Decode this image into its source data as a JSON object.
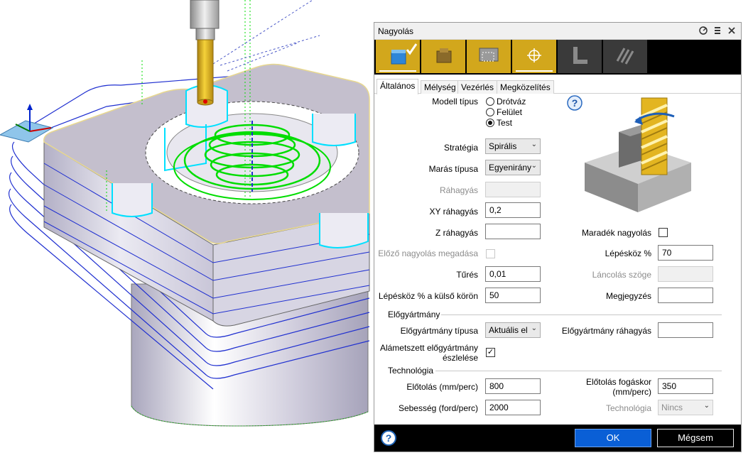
{
  "dialog": {
    "title": "Nagyolás",
    "title_icons": [
      "pin-icon",
      "menu-icon",
      "close-icon"
    ],
    "toolbar": [
      {
        "icon": "pocket-icon",
        "active": true,
        "checked": true
      },
      {
        "icon": "stock-box-icon",
        "active": false
      },
      {
        "icon": "region-icon",
        "active": false
      },
      {
        "icon": "target-icon",
        "active": true
      },
      {
        "icon": "corner-icon",
        "active": false
      },
      {
        "icon": "zigzag-icon",
        "active": false
      }
    ],
    "tabs": [
      "Általános",
      "Mélység",
      "Vezérlés",
      "Megközelítés"
    ],
    "active_tab": "Általános",
    "model_type": {
      "label": "Modell típus",
      "options": [
        "Drótváz",
        "Felület",
        "Test"
      ],
      "selected": "Test"
    },
    "help_glyph": "?",
    "strategy": {
      "label": "Stratégia",
      "value": "Spirális"
    },
    "milling_type": {
      "label": "Marás típusa",
      "value": "Egyenirány"
    },
    "allowance": {
      "label": "Ráhagyás",
      "value": ""
    },
    "xy_allowance": {
      "label": "XY ráhagyás",
      "value": "0,2"
    },
    "z_allowance": {
      "label": "Z ráhagyás",
      "value": ""
    },
    "prev_roughing": {
      "label": "Előző nagyolás megadása",
      "checked": false
    },
    "tolerance": {
      "label": "Tűrés",
      "value": "0,01"
    },
    "outer_stepover": {
      "label": "Lépésköz % a külső körön",
      "value": "50"
    },
    "rest_roughing": {
      "label": "Maradék nagyolás",
      "checked": false
    },
    "stepover": {
      "label": "Lépésköz %",
      "value": "70"
    },
    "chaining_angle": {
      "label": "Láncolás szöge",
      "value": ""
    },
    "note": {
      "label": "Megjegyzés",
      "value": ""
    },
    "stock_section": "Előgyártmány",
    "stock_type": {
      "label": "Előgyártmány típusa",
      "value": "Aktuális el"
    },
    "stock_allowance": {
      "label": "Előgyártmány ráhagyás",
      "value": ""
    },
    "default_stock": {
      "label_line1": "Alámetszett előgyártmány",
      "label_line2": "észlelése",
      "checked": true
    },
    "tech_section": "Technológia",
    "feed": {
      "label": "Előtolás (mm/perc)",
      "value": "800"
    },
    "plunge_feed": {
      "label_line1": "Előtolás fogáskor",
      "label_line2": "(mm/perc)",
      "value": "350"
    },
    "speed": {
      "label": "Sebesség (ford/perc)",
      "value": "2000"
    },
    "technology": {
      "label": "Technológia",
      "value": "Nincs"
    },
    "ok_label": "OK",
    "cancel_label": "Mégsem"
  },
  "colors": {
    "accent": "#d2a71c",
    "ok_button": "#0a5fd6",
    "toolpath": "#00dd00",
    "edge_highlight": "#00e0ff",
    "contour": "#1f2fd0"
  }
}
